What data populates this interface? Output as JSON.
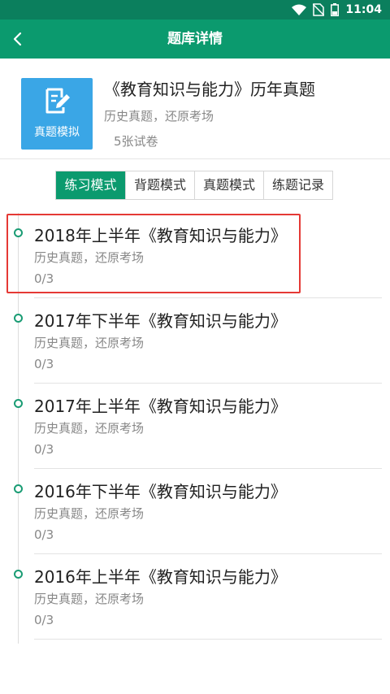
{
  "status_bar": {
    "time": "11:04"
  },
  "app_bar": {
    "title": "题库详情"
  },
  "book": {
    "cover_text": "真题模拟",
    "title": "《教育知识与能力》历年真题",
    "subtitle": "历史真题，还原考场",
    "count": "5张试卷"
  },
  "tabs": [
    {
      "label": "练习模式",
      "active": true
    },
    {
      "label": "背题模式",
      "active": false
    },
    {
      "label": "真题模式",
      "active": false
    },
    {
      "label": "练题记录",
      "active": false
    }
  ],
  "papers": [
    {
      "title": "2018年上半年《教育知识与能力》",
      "subtitle": "历史真题，还原考场",
      "progress": "0/3"
    },
    {
      "title": "2017年下半年《教育知识与能力》",
      "subtitle": "历史真题，还原考场",
      "progress": "0/3"
    },
    {
      "title": "2017年上半年《教育知识与能力》",
      "subtitle": "历史真题，还原考场",
      "progress": "0/3"
    },
    {
      "title": "2016年下半年《教育知识与能力》",
      "subtitle": "历史真题，还原考场",
      "progress": "0/3"
    },
    {
      "title": "2016年上半年《教育知识与能力》",
      "subtitle": "历史真题，还原考场",
      "progress": "0/3"
    }
  ],
  "colors": {
    "primary": "#0b9a6e",
    "status": "#0b7f5d",
    "cover": "#3aa6e6",
    "highlight": "#e53935"
  },
  "icons": [
    "wifi-icon",
    "no-sim-icon",
    "battery-icon",
    "back-arrow-icon",
    "pencil-paper-icon",
    "timeline-dot-icon"
  ]
}
